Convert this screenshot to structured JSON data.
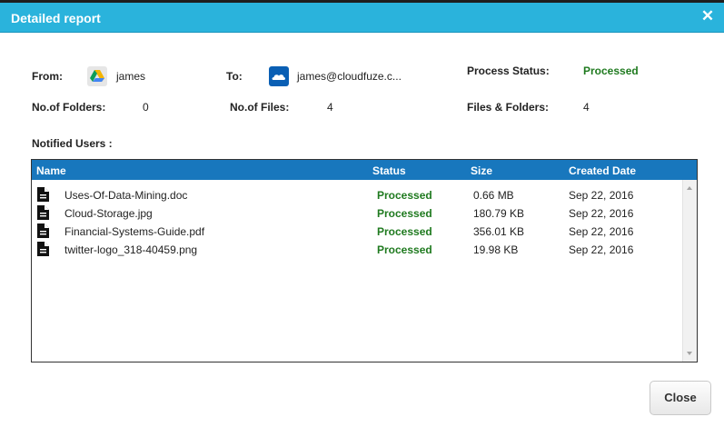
{
  "header": {
    "title": "Detailed report",
    "close_glyph": "✕"
  },
  "summary": {
    "from_label": "From:",
    "from_value": "james",
    "to_label": "To:",
    "to_value": "james@cloudfuze.c...",
    "process_status_label": "Process Status:",
    "process_status_value": "Processed",
    "folders_label": "No.of Folders:",
    "folders_value": "0",
    "files_label": "No.of Files:",
    "files_value": "4",
    "files_folders_label": "Files & Folders:",
    "files_folders_value": "4",
    "notified_label": "Notified Users :"
  },
  "icons": {
    "from": "google-drive-icon",
    "to": "onedrive-icon",
    "file": "document-icon"
  },
  "colors": {
    "header": "#2ab3dc",
    "table_header": "#1877bd",
    "processed": "#1f7a1f"
  },
  "table": {
    "columns": [
      "Name",
      "Status",
      "Size",
      "Created Date"
    ],
    "rows": [
      {
        "name": "Uses-Of-Data-Mining.doc",
        "status": "Processed",
        "size": "0.66 MB",
        "date": "Sep 22, 2016"
      },
      {
        "name": "Cloud-Storage.jpg",
        "status": "Processed",
        "size": "180.79 KB",
        "date": "Sep 22, 2016"
      },
      {
        "name": "Financial-Systems-Guide.pdf",
        "status": "Processed",
        "size": "356.01 KB",
        "date": "Sep 22, 2016"
      },
      {
        "name": "twitter-logo_318-40459.png",
        "status": "Processed",
        "size": "19.98 KB",
        "date": "Sep 22, 2016"
      }
    ]
  },
  "footer": {
    "close_label": "Close"
  }
}
